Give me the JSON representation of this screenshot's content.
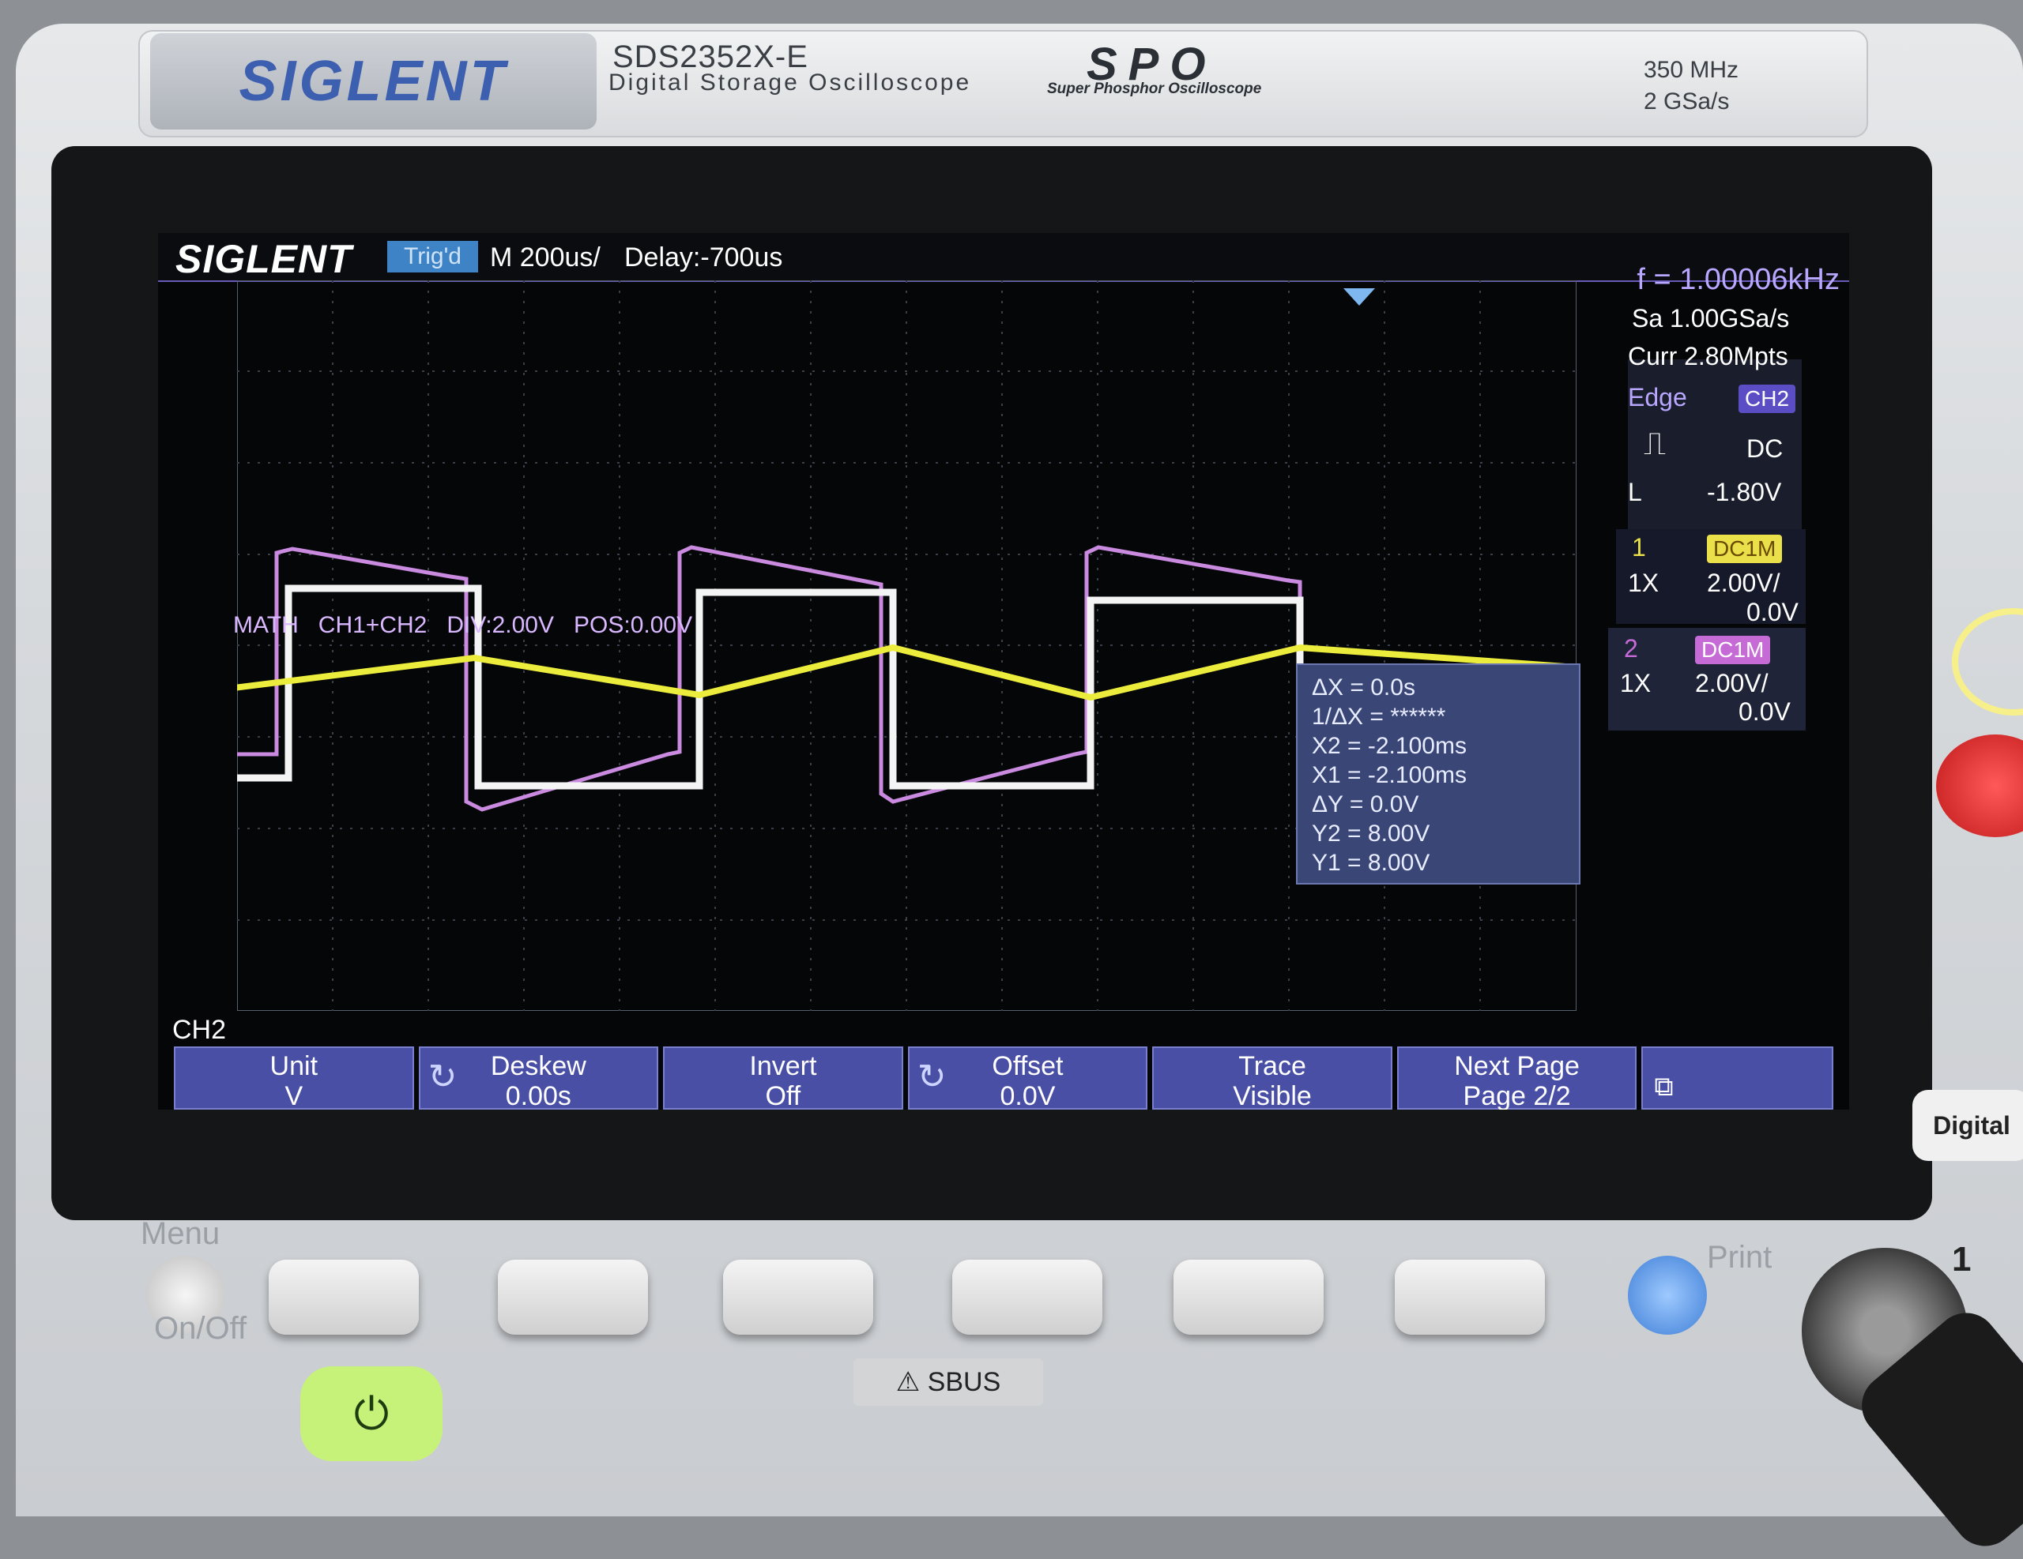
{
  "device": {
    "brand": "SIGLENT",
    "model": "SDS2352X-E",
    "subtitle": "Digital Storage Oscilloscope",
    "spo_logo": "SPO",
    "spo_subtitle": "Super Phosphor Oscilloscope",
    "bandwidth": "350 MHz",
    "sample_rate_max": "2 GSa/s"
  },
  "screen": {
    "logo": "SIGLENT",
    "trigger_status": "Trig'd",
    "timebase": "M 200us/",
    "delay": "Delay:-700us",
    "frequency": "f = 1.00006kHz",
    "sample_rate": "Sa 1.00GSa/s",
    "memory_depth": "Curr 2.80Mpts"
  },
  "trigger": {
    "type": "Edge",
    "source": "CH2",
    "slope_icon": "rising-edge-icon",
    "coupling": "DC",
    "level_label": "L",
    "level": "-1.80V"
  },
  "channels": [
    {
      "id": "1",
      "coupling": "DC1M",
      "probe": "1X",
      "scale": "2.00V/",
      "offset": "0.0V",
      "color": "#e9e04a"
    },
    {
      "id": "2",
      "coupling": "DC1M",
      "probe": "1X",
      "scale": "2.00V/",
      "offset": "0.0V",
      "color": "#c66bd6"
    }
  ],
  "math": {
    "label": "MATH",
    "expr": "CH1+CH2",
    "div": "DIV:2.00V",
    "pos": "POS:0.00V"
  },
  "cursors": {
    "dx": "ΔX = 0.0s",
    "inv_dx": "1/ΔX = ******",
    "x2": "X2 = -2.100ms",
    "x1": "X1 = -2.100ms",
    "dy": "ΔY = 0.0V",
    "y2": "Y2 = 8.00V",
    "y1": "Y1 = 8.00V"
  },
  "menu": {
    "title": "CH2",
    "items": [
      {
        "label": "Unit",
        "value": "V"
      },
      {
        "label": "Deskew",
        "value": "0.00s"
      },
      {
        "label": "Invert",
        "value": "Off"
      },
      {
        "label": "Offset",
        "value": "0.0V"
      },
      {
        "label": "Trace",
        "value": "Visible"
      },
      {
        "label": "Next Page",
        "value": "Page 2/2"
      }
    ],
    "network_icon": "network-icon"
  },
  "panel": {
    "menu_label": "Menu",
    "onoff_label": "On/Off",
    "print_label": "Print",
    "sbus_label": "SBUS",
    "digital_label": "Digital",
    "input_number": "1"
  },
  "colors": {
    "ch1": "#e9e04a",
    "ch2_white": "#ffffff",
    "ch2_pink": "#c66bd6",
    "accent": "#4a4fa6"
  }
}
